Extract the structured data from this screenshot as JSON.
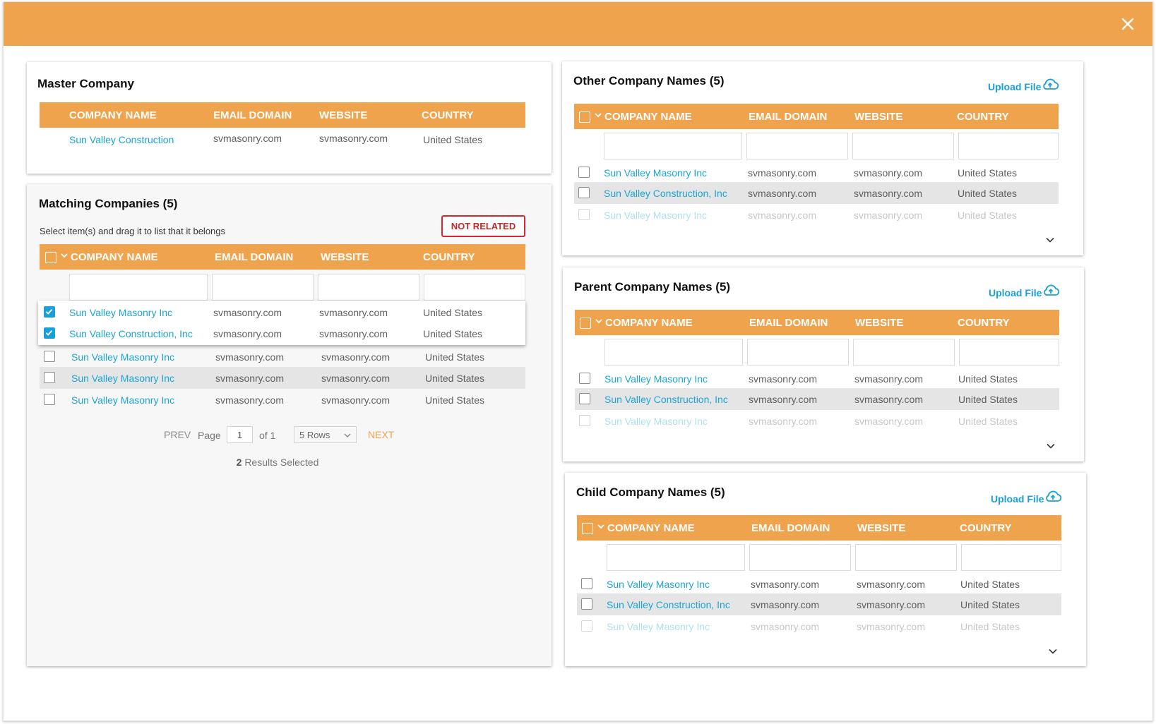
{
  "columns": [
    "COMPANY NAME",
    "EMAIL DOMAIN",
    "WEBSITE",
    "COUNTRY"
  ],
  "master": {
    "title": "Master Company",
    "row": {
      "name": "Sun Valley Construction",
      "email": "svmasonry.com",
      "website": "svmasonry.com",
      "country": "United States"
    }
  },
  "matching": {
    "title": "Matching Companies (5)",
    "instruction": "Select item(s) and drag it to list that it belongs",
    "not_related_label": "NOT RELATED",
    "rows": [
      {
        "name": "Sun Valley Masonry Inc",
        "email": "svmasonry.com",
        "website": "svmasonry.com",
        "country": "United States",
        "checked": true
      },
      {
        "name": "Sun Valley Construction, Inc",
        "email": "svmasonry.com",
        "website": "svmasonry.com",
        "country": "United States",
        "checked": true
      },
      {
        "name": "Sun Valley Masonry Inc",
        "email": "svmasonry.com",
        "website": "svmasonry.com",
        "country": "United States",
        "checked": false
      },
      {
        "name": "Sun Valley Masonry Inc",
        "email": "svmasonry.com",
        "website": "svmasonry.com",
        "country": "United States",
        "checked": false
      },
      {
        "name": "Sun Valley Masonry Inc",
        "email": "svmasonry.com",
        "website": "svmasonry.com",
        "country": "United States",
        "checked": false
      }
    ],
    "pagination": {
      "prev_label": "PREV",
      "page_label": "Page",
      "page_value": "1",
      "of_label": "of 1",
      "rows_option": "5 Rows",
      "next_label": "NEXT",
      "selected_count": "2",
      "selected_label": "Results Selected"
    }
  },
  "upload_label": "Upload File",
  "other": {
    "title": "Other Company Names (5)",
    "rows": [
      {
        "name": "Sun Valley Masonry Inc",
        "email": "svmasonry.com",
        "website": "svmasonry.com",
        "country": "United States"
      },
      {
        "name": "Sun Valley Construction, Inc",
        "email": "svmasonry.com",
        "website": "svmasonry.com",
        "country": "United States"
      },
      {
        "name": "Sun Valley Masonry Inc",
        "email": "svmasonry.com",
        "website": "svmasonry.com",
        "country": "United States"
      }
    ]
  },
  "parent": {
    "title": "Parent Company Names (5)",
    "rows": [
      {
        "name": "Sun Valley Masonry Inc",
        "email": "svmasonry.com",
        "website": "svmasonry.com",
        "country": "United States"
      },
      {
        "name": "Sun Valley Construction, Inc",
        "email": "svmasonry.com",
        "website": "svmasonry.com",
        "country": "United States"
      },
      {
        "name": "Sun Valley Masonry Inc",
        "email": "svmasonry.com",
        "website": "svmasonry.com",
        "country": "United States"
      }
    ]
  },
  "child": {
    "title": "Child Company Names (5)",
    "rows": [
      {
        "name": "Sun Valley Masonry Inc",
        "email": "svmasonry.com",
        "website": "svmasonry.com",
        "country": "United States"
      },
      {
        "name": "Sun Valley Construction, Inc",
        "email": "svmasonry.com",
        "website": "svmasonry.com",
        "country": "United States"
      },
      {
        "name": "Sun Valley Masonry Inc",
        "email": "svmasonry.com",
        "website": "svmasonry.com",
        "country": "United States"
      }
    ]
  },
  "colors": {
    "accent": "#f0a34d",
    "link": "#1aa5d6",
    "danger": "#d9262c",
    "checkbox": "#1aa0d8"
  }
}
